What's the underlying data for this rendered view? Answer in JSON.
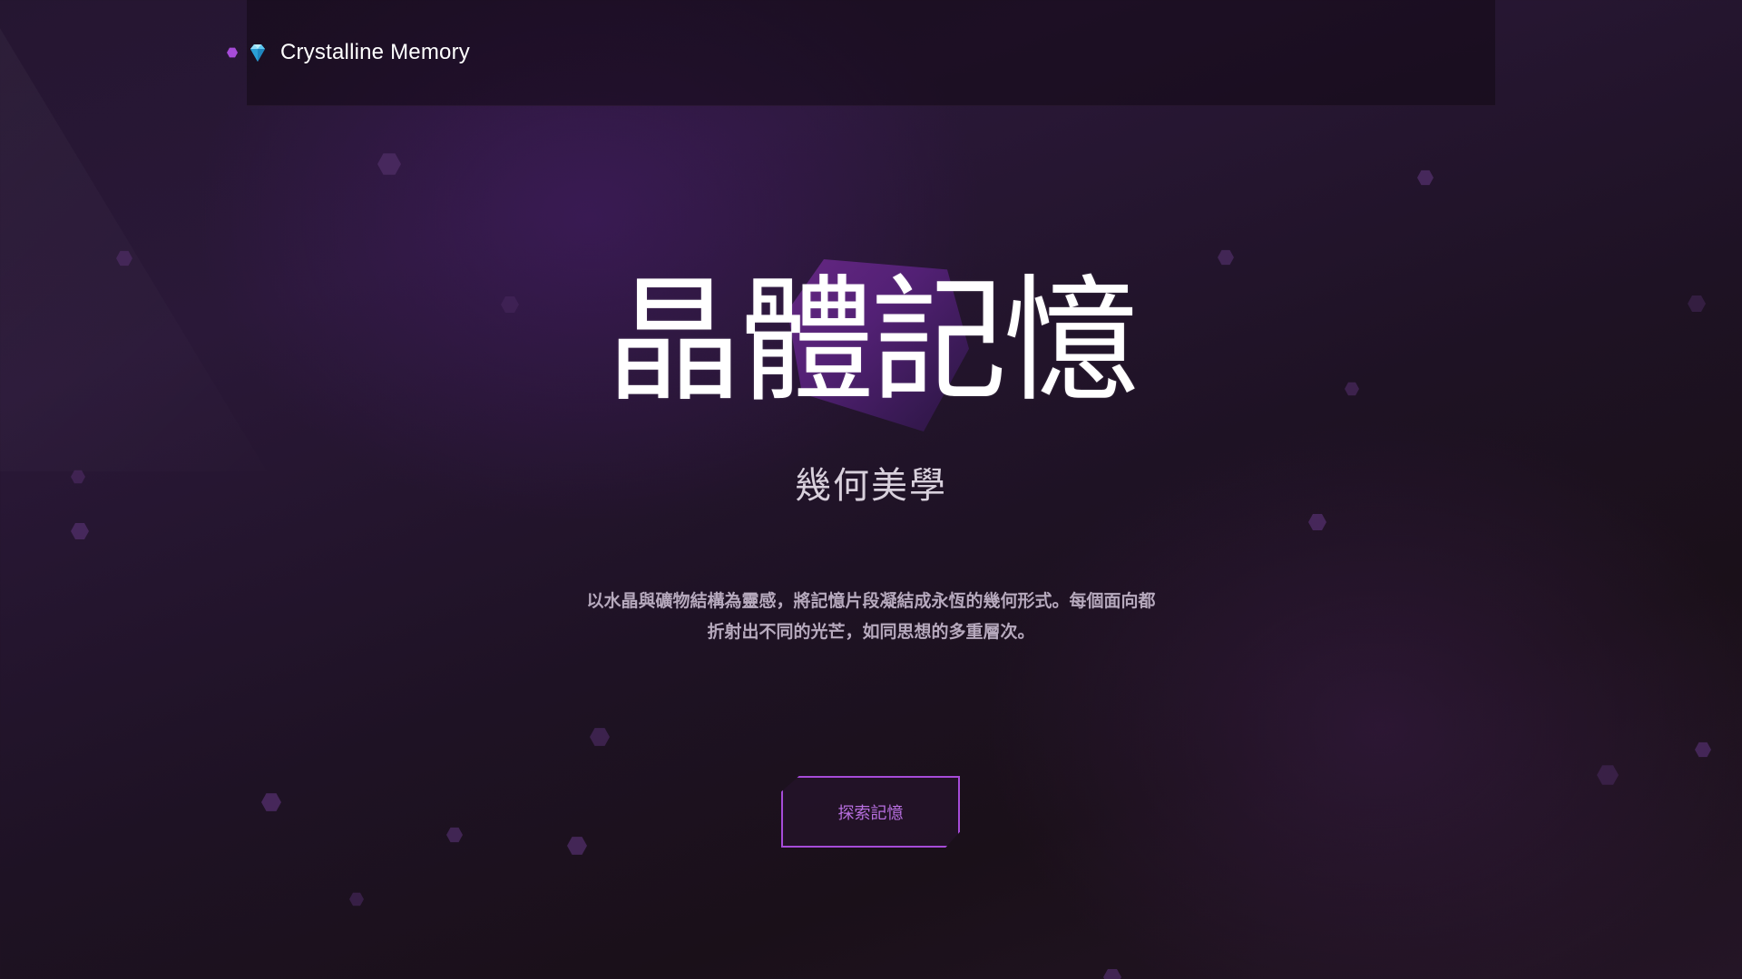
{
  "header": {
    "brand_icon": "gem-icon",
    "brand_name": "Crystalline Memory"
  },
  "hero": {
    "title": "晶體記憶",
    "subtitle": "幾何美學",
    "description": "以水晶與礦物結構為靈感，將記憶片段凝結成永恆的幾何形式。每個面向都折射出不同的光芒，如同思想的多重層次。",
    "cta_label": "探索記憶"
  },
  "colors": {
    "accent": "#a64bd8",
    "background": "#1e1224",
    "button_text": "#b86fe0",
    "title": "#ffffff"
  }
}
